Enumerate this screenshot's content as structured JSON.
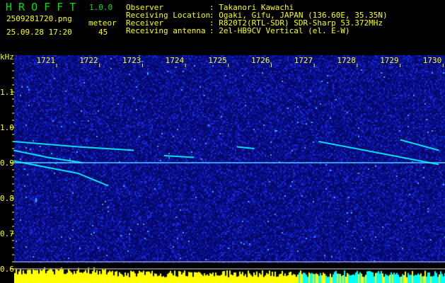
{
  "header": {
    "app_title": "H R O F F T",
    "version": "1.0.0",
    "filename": "2509281720.png",
    "datetime": "25.09.28 17:20",
    "meteor_label": "meteor",
    "meteor_count": "45",
    "info": [
      {
        "label": "Observer",
        "value": ": Takanori Kawachi"
      },
      {
        "label": "Receiving Location",
        "value": ": Ogaki, Gifu, JAPAN (136.60E, 35.35N)"
      },
      {
        "label": "Receiver",
        "value": ": R820T2(RTL-SDR) SDR-Sharp 53.372MHz"
      },
      {
        "label": "Receiving antenna",
        "value": ": 2el-HB9CV Vertical (el. E-W)"
      }
    ]
  },
  "chart_data": {
    "type": "heatmap",
    "ylabel": "kHz",
    "x_ticks": [
      "1721",
      "1722",
      "1723",
      "1724",
      "1725",
      "1726",
      "1727",
      "1728",
      "1729",
      "1730"
    ],
    "y_ticks": [
      "1.1",
      "1.0",
      "0.9",
      "0.8",
      "0.7",
      "0.6"
    ],
    "ylim": [
      0.6,
      1.2
    ],
    "xlim": [
      1720.0,
      1730.0
    ],
    "carrier_khz": 0.9,
    "traces": [
      {
        "t": [
          1720.0,
          1721.5,
          1722.2
        ],
        "f": [
          0.905,
          0.87,
          0.835
        ]
      },
      {
        "t": [
          1720.0,
          1720.8,
          1721.6
        ],
        "f": [
          0.935,
          0.915,
          0.9
        ]
      },
      {
        "t": [
          1720.0,
          1721.5,
          1722.8
        ],
        "f": [
          0.96,
          0.945,
          0.935
        ]
      },
      {
        "t": [
          1723.5,
          1724.2
        ],
        "f": [
          0.92,
          0.915
        ]
      },
      {
        "t": [
          1725.2,
          1725.6
        ],
        "f": [
          0.945,
          0.94
        ]
      },
      {
        "t": [
          1727.1,
          1728.4,
          1729.9
        ],
        "f": [
          0.96,
          0.93,
          0.895
        ]
      },
      {
        "t": [
          1729.0,
          1729.9
        ],
        "f": [
          0.965,
          0.935
        ]
      }
    ],
    "colors": {
      "text": "#ffff00",
      "title": "#00e000",
      "background": "#000080",
      "trace": "#00ffff",
      "bottom_graph": "#ffff00",
      "bottom_graph_alt": "#00ffff"
    }
  }
}
